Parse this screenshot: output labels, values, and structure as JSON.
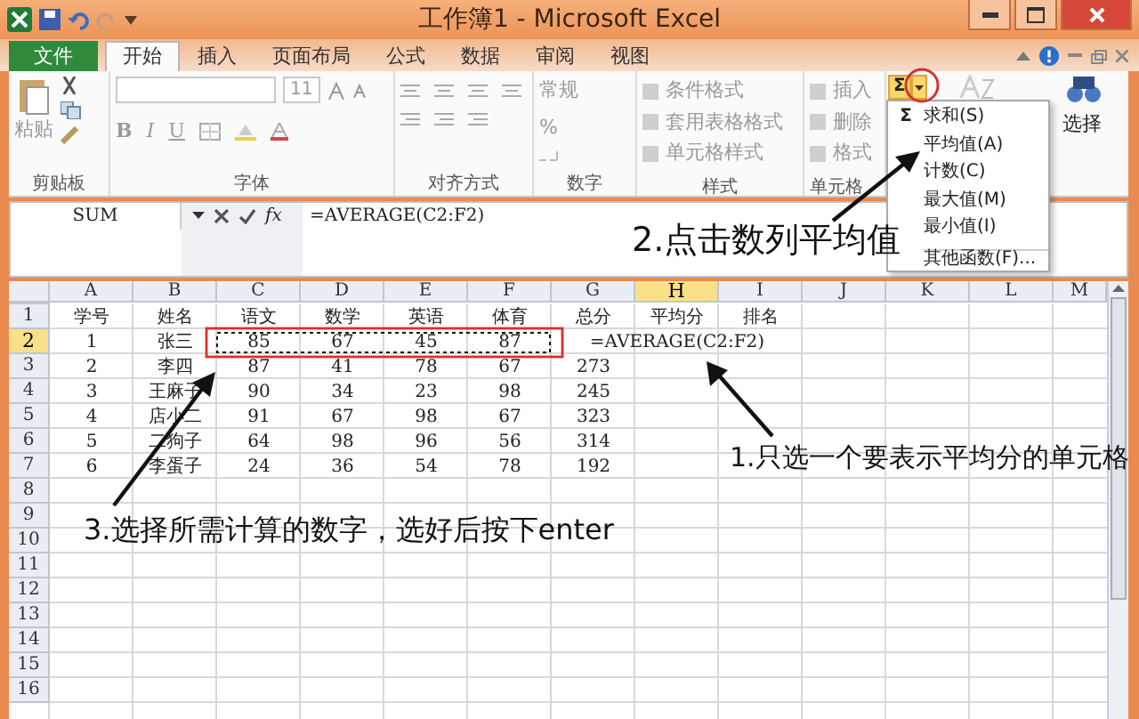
{
  "window": {
    "title": "工作簿1 - Microsoft Excel"
  },
  "ribbon_tabs": [
    {
      "label": "文件",
      "kind": "file",
      "selected": false
    },
    {
      "label": "开始",
      "kind": "tab",
      "selected": true
    },
    {
      "label": "插入",
      "kind": "tab",
      "selected": false
    },
    {
      "label": "页面布局",
      "kind": "tab",
      "selected": false
    },
    {
      "label": "公式",
      "kind": "tab",
      "selected": false
    },
    {
      "label": "数据",
      "kind": "tab",
      "selected": false
    },
    {
      "label": "审阅",
      "kind": "tab",
      "selected": false
    },
    {
      "label": "视图",
      "kind": "tab",
      "selected": false
    }
  ],
  "ribbon_groups": [
    {
      "kind": "clipboard",
      "label": "剪贴板",
      "paste": "粘贴"
    },
    {
      "kind": "font",
      "label": "字体",
      "font_size": "11",
      "buttons": [
        "B",
        "I",
        "U"
      ]
    },
    {
      "kind": "alignment",
      "label": "对齐方式"
    },
    {
      "kind": "number",
      "label": "数字",
      "format": "常规",
      "percent": "%"
    },
    {
      "kind": "list",
      "label": "样式",
      "items": [
        {
          "label": "条件格式",
          "disabled": true
        },
        {
          "label": "套用表格格式",
          "disabled": true
        },
        {
          "label": "单元格样式",
          "disabled": true
        }
      ]
    },
    {
      "kind": "list",
      "label": "单元格",
      "items": [
        {
          "label": "插入",
          "disabled": true
        },
        {
          "label": "删除",
          "disabled": true
        },
        {
          "label": "格式",
          "disabled": true
        }
      ]
    },
    {
      "kind": "editing",
      "autosum": "Σ",
      "select": "选择"
    }
  ],
  "autosum_menu": {
    "expanded": true,
    "items": [
      {
        "icon": "Σ",
        "label": "求和(S)",
        "separator_before": false
      },
      {
        "label": "平均值(A)",
        "separator_before": false
      },
      {
        "label": "计数(C)",
        "separator_before": false
      },
      {
        "label": "最大值(M)",
        "separator_before": false
      },
      {
        "label": "最小值(I)",
        "separator_before": false
      },
      {
        "label": "其他函数(F)...",
        "separator_before": true
      }
    ]
  },
  "formula_bar": {
    "name_box": "SUM",
    "fx": "fx",
    "formula": "=AVERAGE(C2:F2)"
  },
  "sheet": {
    "columns": [
      {
        "label": "A",
        "selected": false
      },
      {
        "label": "B",
        "selected": false
      },
      {
        "label": "C",
        "selected": false
      },
      {
        "label": "D",
        "selected": false
      },
      {
        "label": "E",
        "selected": false
      },
      {
        "label": "F",
        "selected": false
      },
      {
        "label": "G",
        "selected": false
      },
      {
        "label": "H",
        "selected": true
      },
      {
        "label": "I",
        "selected": false
      },
      {
        "label": "J",
        "selected": false
      },
      {
        "label": "K",
        "selected": false
      },
      {
        "label": "L",
        "selected": false
      },
      {
        "label": "M",
        "selected": false
      }
    ],
    "rows": [
      {
        "number": "1",
        "selected": false,
        "cells": [
          "学号",
          "姓名",
          "语文",
          "数学",
          "英语",
          "体育",
          "总分",
          "平均分",
          "排名"
        ]
      },
      {
        "number": "2",
        "selected": true,
        "cells": [
          "1",
          "张三",
          "85",
          "67",
          "45",
          "87",
          null,
          "=AVERAGE(C2:F2)"
        ]
      },
      {
        "number": "3",
        "selected": false,
        "cells": [
          "2",
          "李四",
          "87",
          "41",
          "78",
          "67",
          "273"
        ]
      },
      {
        "number": "4",
        "selected": false,
        "cells": [
          "3",
          "王麻子",
          "90",
          "34",
          "23",
          "98",
          "245"
        ]
      },
      {
        "number": "5",
        "selected": false,
        "cells": [
          "4",
          "店小二",
          "91",
          "67",
          "98",
          "67",
          "323"
        ]
      },
      {
        "number": "6",
        "selected": false,
        "cells": [
          "5",
          "二狗子",
          "64",
          "98",
          "96",
          "56",
          "314"
        ]
      },
      {
        "number": "7",
        "selected": false,
        "cells": [
          "6",
          "李蛋子",
          "24",
          "36",
          "54",
          "78",
          "192"
        ]
      },
      {
        "number": "8",
        "selected": false
      },
      {
        "number": "9",
        "selected": false
      },
      {
        "number": "10",
        "selected": false
      },
      {
        "number": "11",
        "selected": false
      },
      {
        "number": "12",
        "selected": false
      },
      {
        "number": "13",
        "selected": false
      },
      {
        "number": "14",
        "selected": false
      },
      {
        "number": "15",
        "selected": false
      },
      {
        "number": "16",
        "selected": false
      }
    ]
  },
  "annotations": [
    {
      "text": "2.点击数列平均值"
    },
    {
      "text": "1.只选一个要表示平均分的单元格"
    },
    {
      "text": "3.选择所需计算的数字，选好后按下enter"
    }
  ]
}
